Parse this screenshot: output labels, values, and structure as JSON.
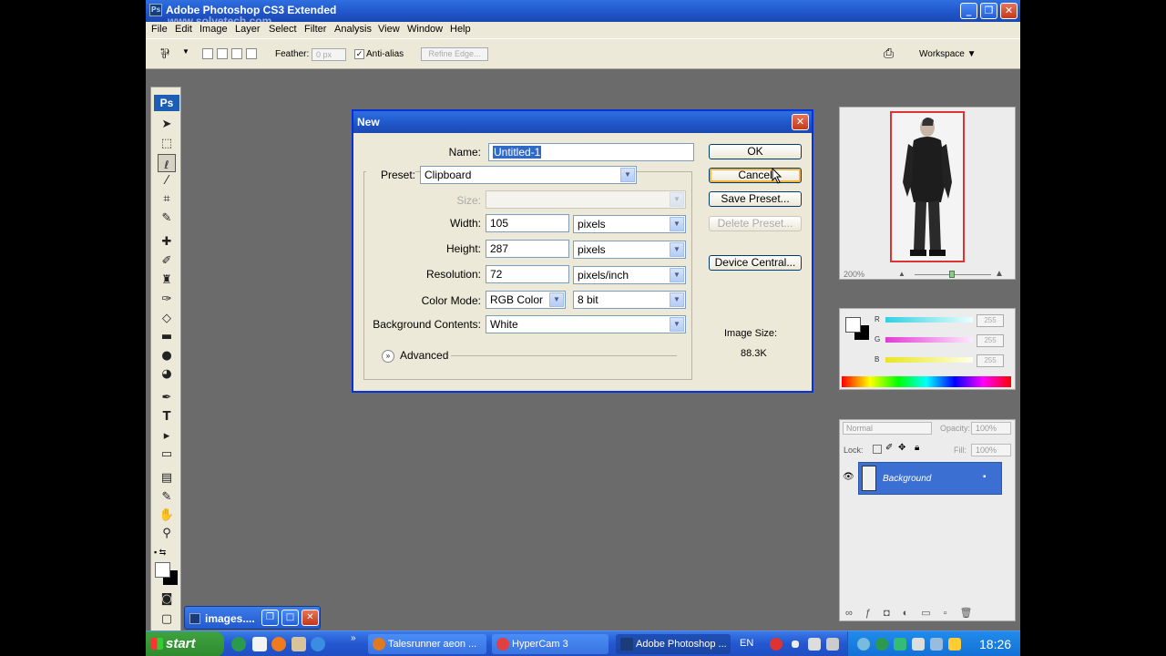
{
  "window": {
    "title": "Adobe Photoshop CS3 Extended",
    "watermark": "www.solvetech.com",
    "controls": {
      "minimize": "_",
      "restore": "❐",
      "close": "✕"
    }
  },
  "menu": [
    "File",
    "Edit",
    "Image",
    "Layer",
    "Select",
    "Filter",
    "Analysis",
    "View",
    "Window",
    "Help"
  ],
  "options_bar": {
    "feather_label": "Feather:",
    "feather_value": "0 px",
    "antialias_label": "Anti-alias",
    "antialias_checked": true,
    "refine_edge": "Refine Edge...",
    "workspace": "Workspace ▼"
  },
  "toolbox": {
    "logo": "Ps",
    "tools": [
      "move-tool",
      "marquee-tool",
      "lasso-tool",
      "magic-wand-tool",
      "crop-tool",
      "eyedropper-tool",
      "healing-brush-tool",
      "brush-tool",
      "clone-stamp-tool",
      "history-brush-tool",
      "eraser-tool",
      "gradient-tool",
      "blur-tool",
      "dodge-tool",
      "pen-tool",
      "type-tool",
      "path-selection-tool",
      "shape-tool",
      "notes-tool",
      "eyedropper-2-tool",
      "hand-tool",
      "zoom-tool"
    ],
    "selected_tool": "lasso-tool"
  },
  "minimized_window": {
    "label": "images...."
  },
  "dialog": {
    "title": "New",
    "name_label": "Name:",
    "name_value": "Untitled-1",
    "preset_label": "Preset:",
    "preset_value": "Clipboard",
    "size_label": "Size:",
    "width_label": "Width:",
    "width_value": "105",
    "width_unit": "pixels",
    "height_label": "Height:",
    "height_value": "287",
    "height_unit": "pixels",
    "resolution_label": "Resolution:",
    "resolution_value": "72",
    "resolution_unit": "pixels/inch",
    "color_mode_label": "Color Mode:",
    "color_mode_value": "RGB Color",
    "bit_depth_value": "8 bit",
    "background_label": "Background Contents:",
    "background_value": "White",
    "advanced_label": "Advanced",
    "buttons": {
      "ok": "OK",
      "cancel": "Cancel",
      "save_preset": "Save Preset...",
      "delete_preset": "Delete Preset...",
      "device_central": "Device Central..."
    },
    "image_size_label": "Image Size:",
    "image_size_value": "88.3K"
  },
  "navigator": {
    "zoom": "200%"
  },
  "color_panel": {
    "channels": [
      {
        "label": "R",
        "value": "255",
        "color": "#2fd0e0"
      },
      {
        "label": "G",
        "value": "255",
        "color": "#e23ad6"
      },
      {
        "label": "B",
        "value": "255",
        "color": "#e8e620"
      }
    ]
  },
  "layers": {
    "blend_mode": "Normal",
    "opacity_label": "Opacity:",
    "opacity_value": "100%",
    "lock_label": "Lock:",
    "fill_label": "Fill:",
    "fill_value": "100%",
    "layer_name": "Background"
  },
  "taskbar": {
    "start": "start",
    "tasks": [
      {
        "label": "Talesrunner aeon ...",
        "active": false
      },
      {
        "label": "HyperCam 3",
        "active": false
      },
      {
        "label": "Adobe Photoshop ...",
        "active": true
      }
    ],
    "language": "EN",
    "clock": "18:26"
  },
  "colors": {
    "xp_blue": "#2457d0",
    "dialog_bg": "#ece9d8",
    "workspace_gray": "#6b6b6b",
    "layer_selected": "#3b6fd1"
  }
}
